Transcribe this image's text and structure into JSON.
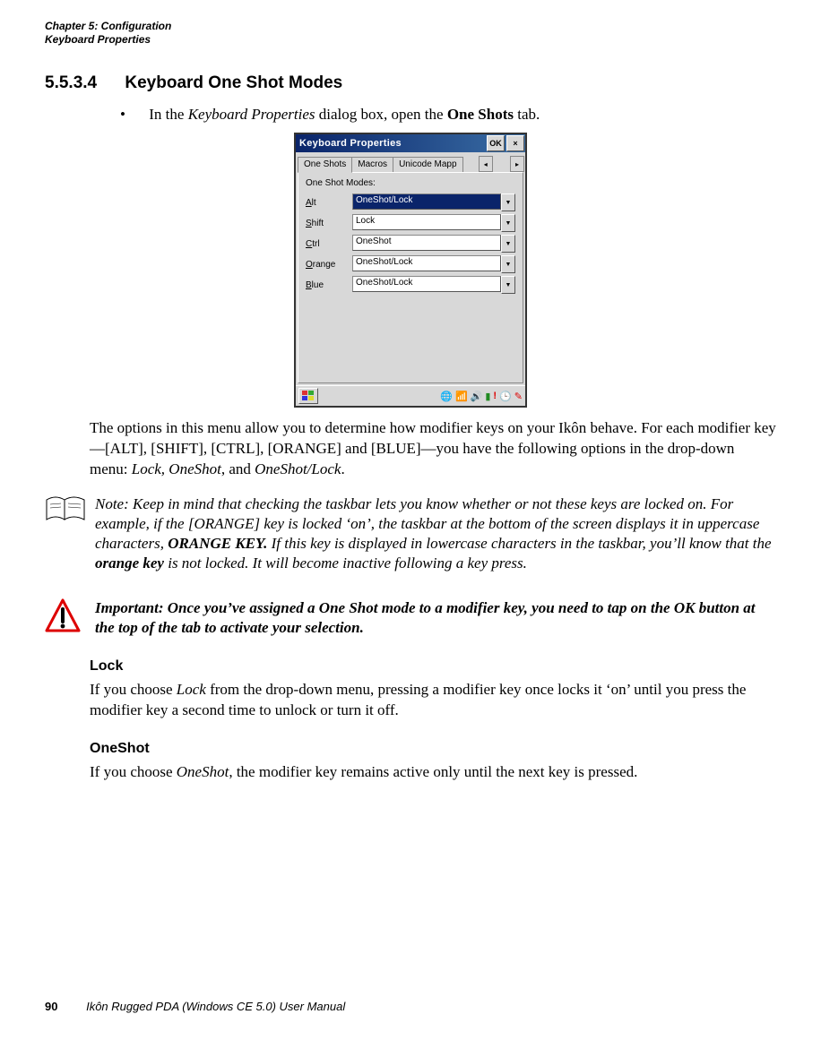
{
  "header": {
    "chapter": "Chapter 5:  Configuration",
    "section": "Keyboard Properties"
  },
  "sec": {
    "num": "5.5.3.4",
    "title": "Keyboard One Shot Modes"
  },
  "bullet": {
    "pre": "In the ",
    "italic": "Keyboard Properties",
    "mid": " dialog box, open the ",
    "bold": "One Shots",
    "post": " tab."
  },
  "dialog": {
    "title": "Keyboard Properties",
    "ok": "OK",
    "tabs": {
      "a": "One Shots",
      "b": "Macros",
      "c": "Unicode Mapp"
    },
    "group": "One Shot Modes:",
    "rows": {
      "alt": {
        "label": "Alt",
        "value": "OneShot/Lock",
        "selected": true,
        "ukey": "A"
      },
      "shift": {
        "label": "Shift",
        "value": "Lock",
        "selected": false,
        "ukey": "S"
      },
      "ctrl": {
        "label": "Ctrl",
        "value": "OneShot",
        "selected": false,
        "ukey": "C"
      },
      "orange": {
        "label": "Orange",
        "value": "OneShot/Lock",
        "selected": false,
        "ukey": "O"
      },
      "blue": {
        "label": "Blue",
        "value": "OneShot/Lock",
        "selected": false,
        "ukey": "B"
      }
    }
  },
  "para1a": "The options in this menu allow you to determine how modifier keys on your Ikôn behave. For each modifier key—[ALT], [SHIFT], [CTRL], [ORANGE] and [BLUE]—you have the following options in the drop-down menu: ",
  "para1i": "Lock, OneShot",
  "para1m": ", and ",
  "para1j": "OneShot/Lock",
  "para1e": ".",
  "note_label": "Note:",
  "note_body_1": " Keep in mind that checking the taskbar lets you know whether or not these keys are locked on. For example, if the [ORANGE] key is locked ‘on’, the taskbar at the bottom of the screen displays it in uppercase characters, ",
  "note_bold1": "ORANGE KEY.",
  "note_body_2": " If this key is displayed in lowercase characters in the taskbar, you’ll know that the ",
  "note_bold2": "orange key",
  "note_body_3": " is not locked. It will become inactive following a key press.",
  "imp_label": "Important:",
  "imp_body": "  Once you’ve assigned a One Shot mode to a modifier key, you need to tap on the OK button at the top of the tab to activate your selection.",
  "lock_h": "Lock",
  "lock_p_a": "If you choose ",
  "lock_p_i": "Lock",
  "lock_p_b": " from the drop-down menu, pressing a modifier key once locks it ‘on’ until you press the modifier key a second time to unlock or turn it off.",
  "one_h": "OneShot",
  "one_p_a": "If you choose ",
  "one_p_i": "OneShot",
  "one_p_b": ", the modifier key remains active only until the next key is pressed.",
  "footer": {
    "page": "90",
    "title": "Ikôn Rugged PDA (Windows CE 5.0) User Manual"
  }
}
